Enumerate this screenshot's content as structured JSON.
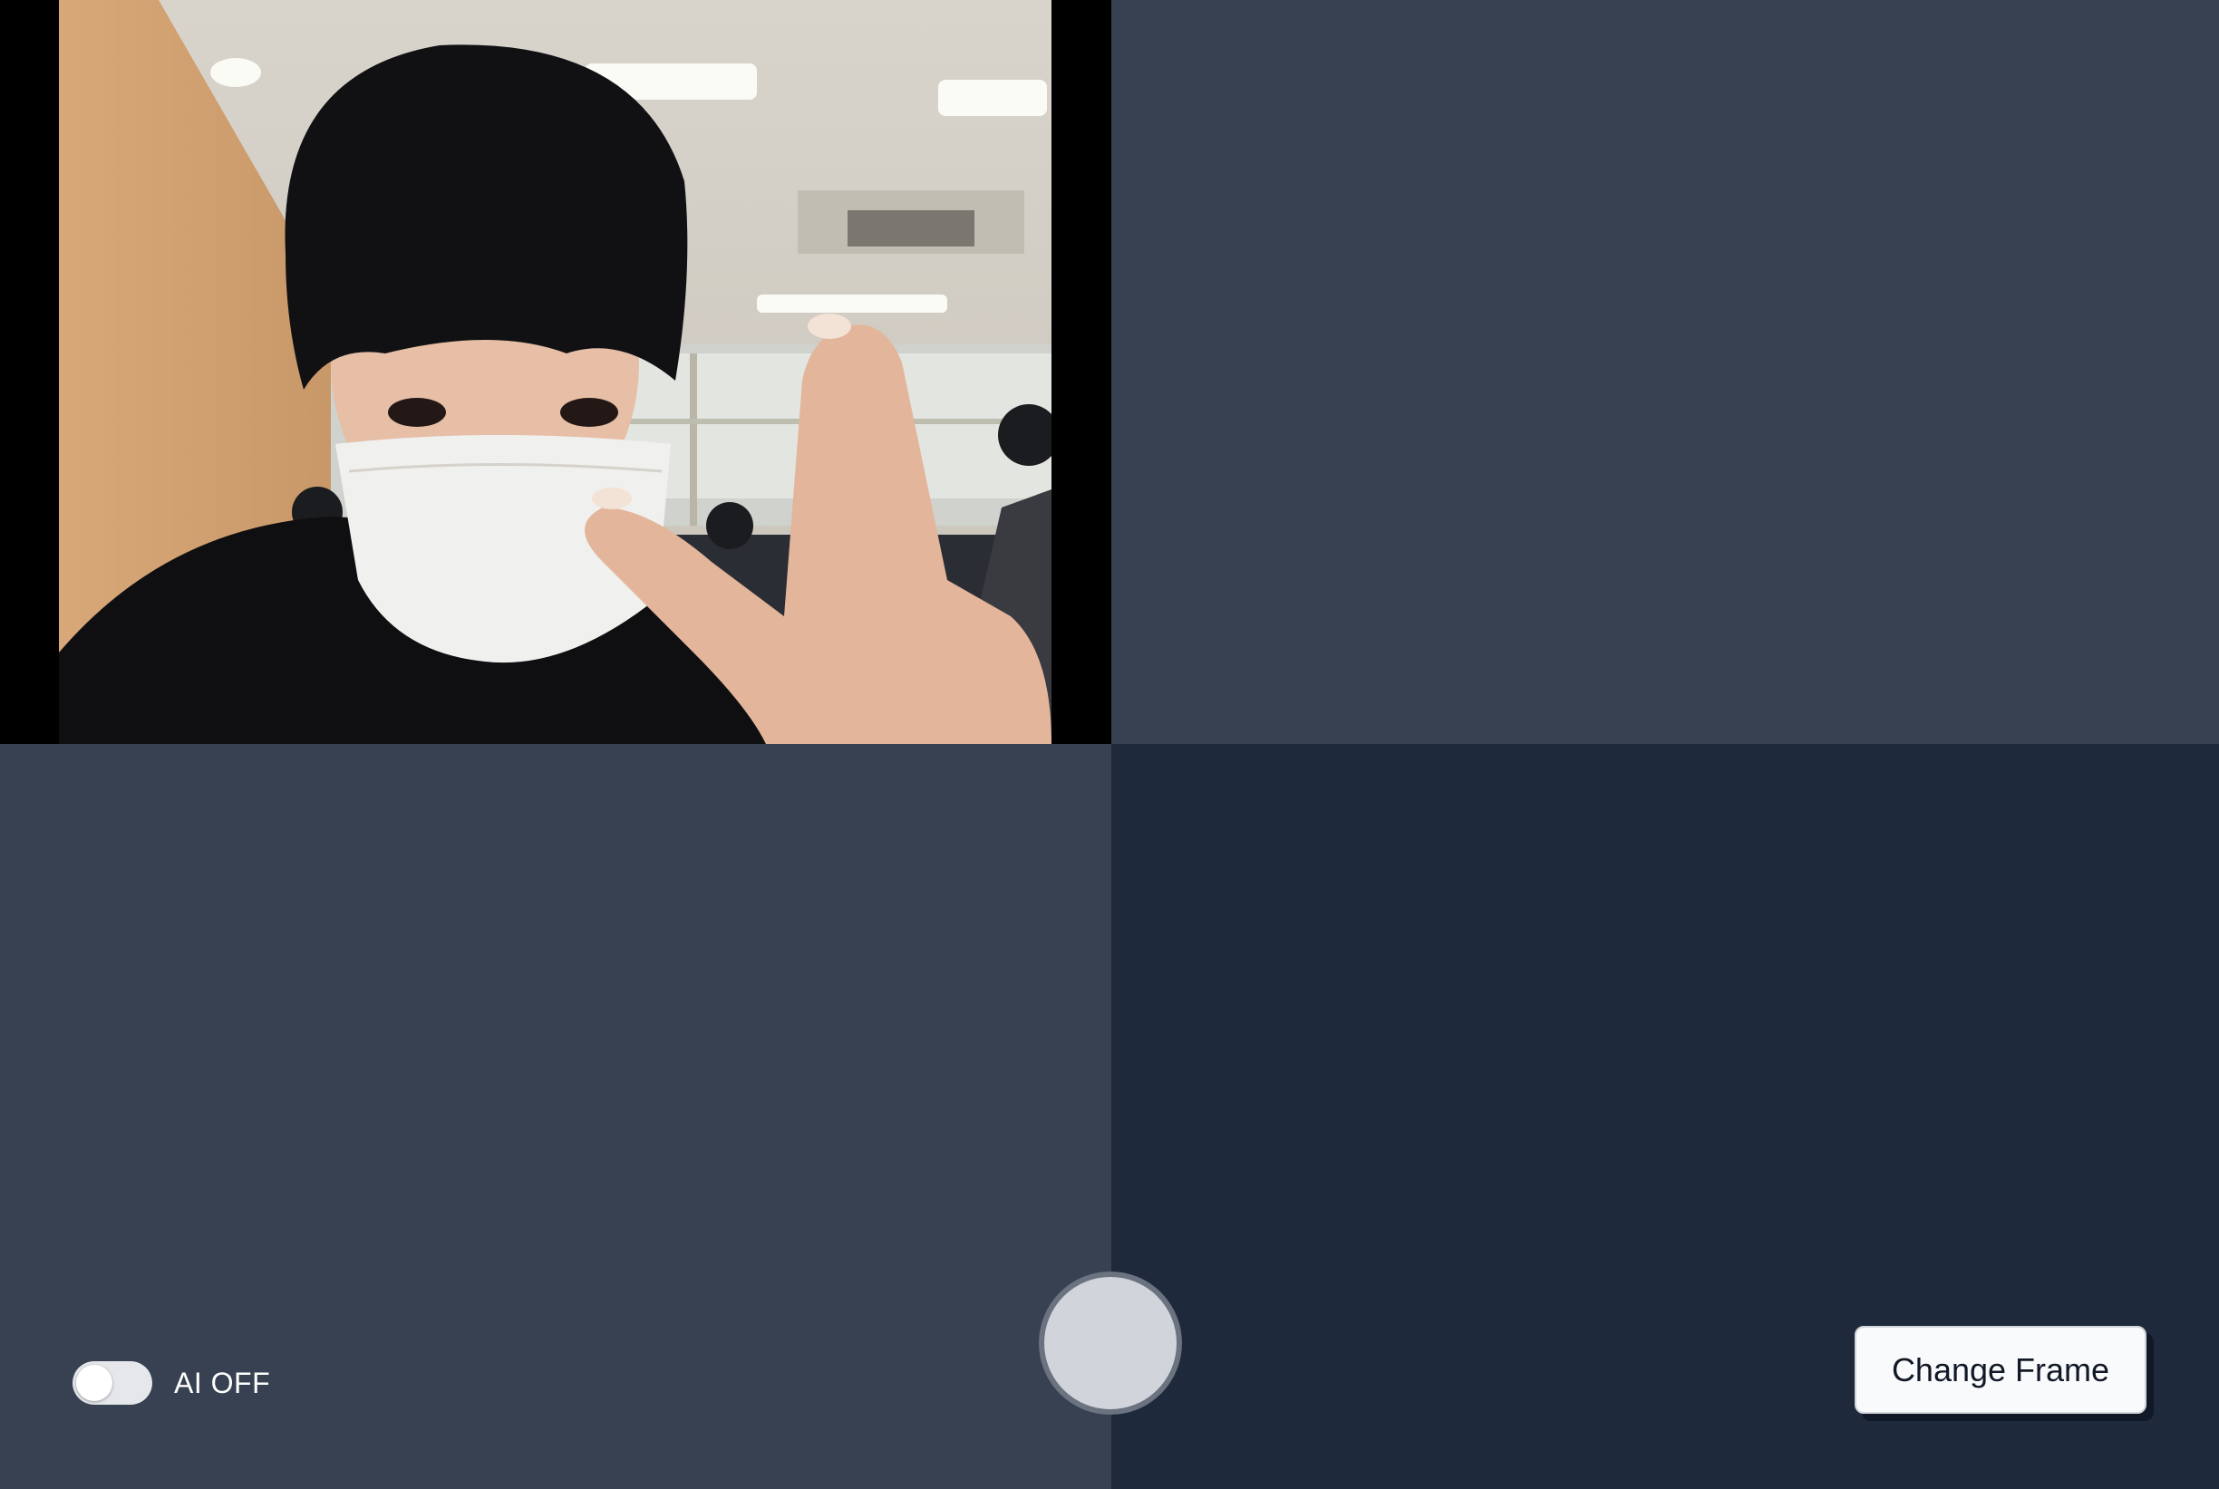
{
  "toggle": {
    "label": "AI OFF",
    "state": "off"
  },
  "buttons": {
    "change_frame_label": "Change Frame"
  },
  "colors": {
    "panel_slate": "#374151",
    "panel_dark": "#1e293b",
    "shutter_fill": "#d1d5db",
    "shutter_ring": "#6b7280",
    "button_bg": "#f9fafb"
  }
}
